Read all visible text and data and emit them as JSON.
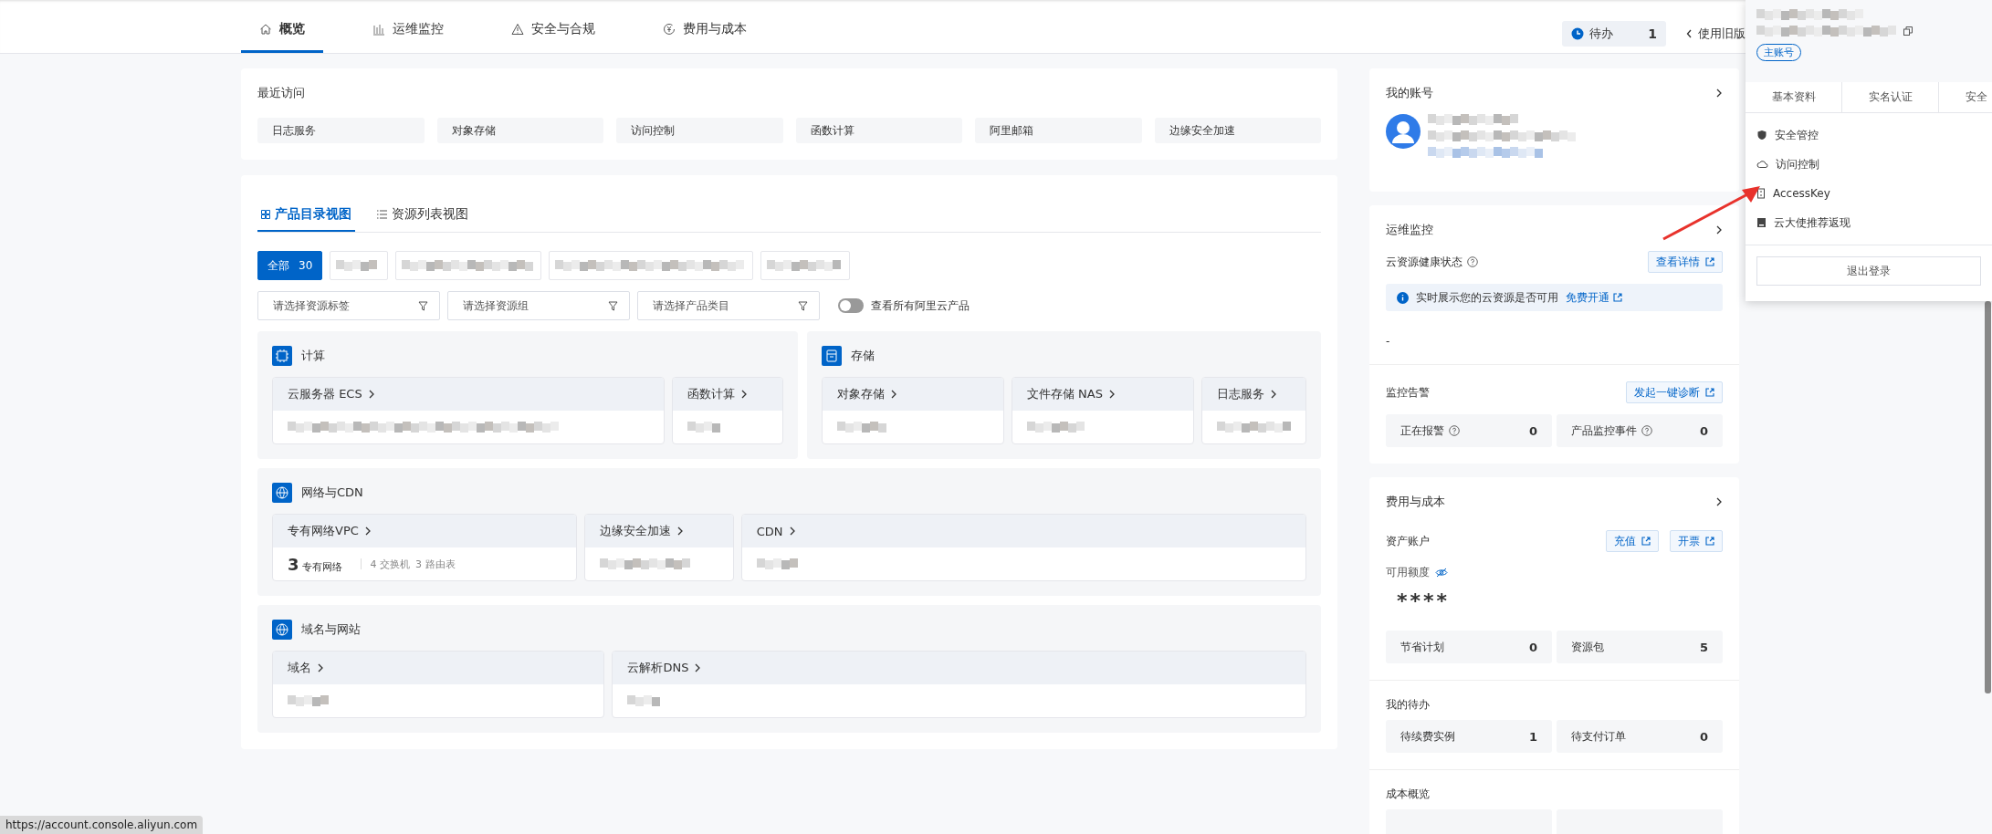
{
  "nav_tabs": [
    {
      "label": "概览",
      "selected": true
    },
    {
      "label": "运维监控",
      "selected": false
    },
    {
      "label": "安全与合规",
      "selected": false
    },
    {
      "label": "费用与成本",
      "selected": false
    }
  ],
  "todo_badge": {
    "label": "待办",
    "count": "1"
  },
  "old_version_link": "使用旧版",
  "recent": {
    "title": "最近访问",
    "items": [
      "日志服务",
      "对象存储",
      "访问控制",
      "函数计算",
      "阿里邮箱",
      "边缘安全加速"
    ]
  },
  "product_panel": {
    "view_tabs": [
      {
        "label": "产品目录视图",
        "selected": true
      },
      {
        "label": "资源列表视图",
        "selected": false
      }
    ],
    "filter_chips": [
      {
        "label": "全部",
        "count": "30",
        "selected": true
      }
    ],
    "filters": [
      {
        "placeholder": "请选择资源标签"
      },
      {
        "placeholder": "请选择资源组"
      },
      {
        "placeholder": "请选择产品类目"
      }
    ],
    "toggle": {
      "label": "查看所有阿里云产品",
      "on": false
    },
    "groups": [
      {
        "title": "计算",
        "kind": "compute",
        "products": [
          {
            "name": "云服务器 ECS"
          },
          {
            "name": "函数计算"
          }
        ]
      },
      {
        "title": "存储",
        "kind": "storage",
        "products": [
          {
            "name": "对象存储"
          },
          {
            "name": "文件存储 NAS"
          },
          {
            "name": "日志服务"
          }
        ]
      },
      {
        "title": "网络与CDN",
        "kind": "globe",
        "products": [
          {
            "name": "专有网络VPC",
            "stats": [
              {
                "value": "3",
                "label": "专有网络"
              }
            ],
            "counts": [
              "4 交换机",
              "3 路由表"
            ]
          },
          {
            "name": "边缘安全加速"
          },
          {
            "name": "CDN"
          }
        ]
      },
      {
        "title": "域名与网站",
        "kind": "globe",
        "products": [
          {
            "name": "域名"
          },
          {
            "name": "云解析DNS"
          }
        ]
      }
    ]
  },
  "account_card": {
    "title": "我的账号"
  },
  "ops_card": {
    "title": "运维监控",
    "health_label": "云资源健康状态",
    "health_button": "查看详情",
    "notice_text": "实时展示您的云资源是否可用",
    "notice_link": "免费开通",
    "health_value": "-",
    "alarm_label": "监控告警",
    "alarm_button": "发起一键诊断",
    "stats": [
      {
        "label": "正在报警",
        "help": true,
        "value": "0"
      },
      {
        "label": "产品监控事件",
        "help": true,
        "value": "0"
      }
    ]
  },
  "cost_card": {
    "title": "费用与成本",
    "asset_label": "资产账户",
    "asset_buttons": [
      "充值",
      "开票"
    ],
    "balance_label": "可用额度",
    "balance_value": "****",
    "stats": [
      {
        "label": "节省计划",
        "help": false,
        "value": "0"
      },
      {
        "label": "资源包",
        "help": false,
        "value": "5"
      }
    ],
    "todo_title": "我的待办",
    "todo_stats": [
      {
        "label": "待续费实例",
        "help": false,
        "value": "1"
      },
      {
        "label": "待支付订单",
        "help": false,
        "value": "0"
      }
    ],
    "overview_title": "成本概览"
  },
  "dropdown": {
    "badge": "主账号",
    "tabs": [
      "基本资料",
      "实名认证",
      "安全"
    ],
    "menu": [
      {
        "label": "安全管控"
      },
      {
        "label": "访问控制"
      },
      {
        "label": "AccessKey"
      },
      {
        "label": "云大使推荐返现"
      }
    ],
    "logout": "退出登录"
  },
  "status_url": "https://account.console.aliyun.com"
}
